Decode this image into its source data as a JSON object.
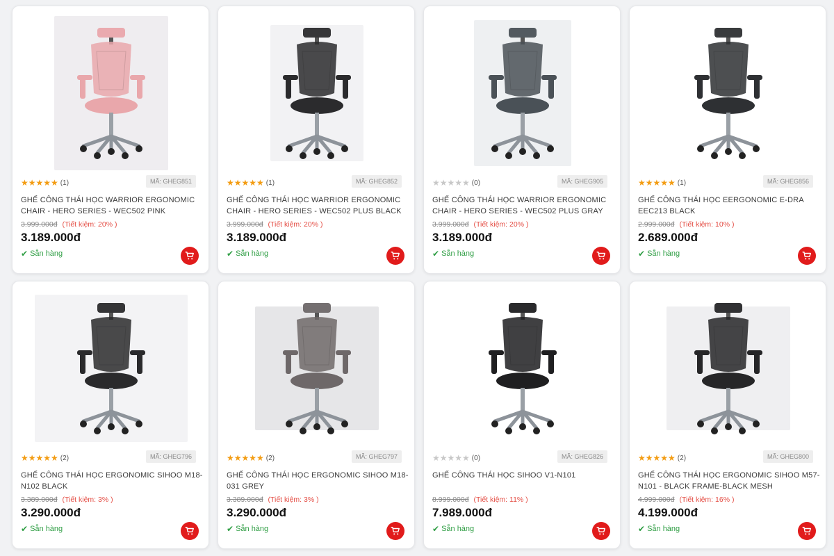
{
  "colors": {
    "accent": "#e11b1b",
    "star_filled": "#f39c12",
    "star_empty": "#c8c8c8",
    "in_stock": "#2f9e44",
    "saving": "#e44d44"
  },
  "products": [
    {
      "stars": "★★★★★",
      "rating_count": "(1)",
      "star_color": "#f39c12",
      "sku": "MÃ: GHEG851",
      "name": "GHẾ CÔNG THÁI HỌC WARRIOR ERGONOMIC CHAIR - HERO SERIES - WEC502 PINK",
      "old_price": "3.999.000đ",
      "saving": "(Tiết kiệm: 20% )",
      "price": "3.189.000đ",
      "stock": "Sẵn hàng",
      "image": "pink office chair",
      "chair_color": "#e9a7ab",
      "bg_color": "#efedf0"
    },
    {
      "stars": "★★★★★",
      "rating_count": "(1)",
      "star_color": "#f39c12",
      "sku": "MÃ: GHEG852",
      "name": "GHẾ CÔNG THÁI HỌC WARRIOR ERGONOMIC CHAIR - HERO SERIES - WEC502 PLUS BLACK",
      "old_price": "3.999.000đ",
      "saving": "(Tiết kiệm: 20% )",
      "price": "3.189.000đ",
      "stock": "Sẵn hàng",
      "image": "black office chair",
      "chair_color": "#2b2b2d",
      "bg_color": "#f2f2f4"
    },
    {
      "stars": "★★★★★",
      "rating_count": "(0)",
      "star_color": "#c8c8c8",
      "sku": "MÃ: GHEG905",
      "name": "GHẾ CÔNG THÁI HỌC WARRIOR ERGONOMIC CHAIR - HERO SERIES - WEC502 PLUS GRAY",
      "old_price": "3.999.000đ",
      "saving": "(Tiết kiệm: 20% )",
      "price": "3.189.000đ",
      "stock": "Sẵn hàng",
      "image": "gray office chair",
      "chair_color": "#4a5157",
      "bg_color": "#eef0f2"
    },
    {
      "stars": "★★★★★",
      "rating_count": "(1)",
      "star_color": "#f39c12",
      "sku": "MÃ: GHEG856",
      "name": "GHẾ CÔNG THÁI HỌC EERGONOMIC E-DRA EEC213 BLACK",
      "old_price": "2.999.000đ",
      "saving": "(Tiết kiệm: 10% )",
      "price": "2.689.000đ",
      "stock": "Sẵn hàng",
      "image": "black office chair",
      "chair_color": "#2e3033",
      "bg_color": "#ffffff"
    },
    {
      "stars": "★★★★★",
      "rating_count": "(2)",
      "star_color": "#f39c12",
      "sku": "MÃ: GHEG796",
      "name": "GHẾ CÔNG THÁI HỌC ERGONOMIC SIHOO M18-N102 BLACK",
      "old_price": "3.389.000đ",
      "saving": "(Tiết kiệm: 3% )",
      "price": "3.290.000đ",
      "stock": "Sẵn hàng",
      "image": "black office chair",
      "chair_color": "#2a2a2c",
      "bg_color": "#f3f3f5"
    },
    {
      "stars": "★★★★★",
      "rating_count": "(2)",
      "star_color": "#f39c12",
      "sku": "MÃ: GHEG797",
      "name": "GHẾ CÔNG THÁI HỌC ERGONOMIC SIHOO M18-031 GREY",
      "old_price": "3.389.000đ",
      "saving": "(Tiết kiệm: 3% )",
      "price": "3.290.000đ",
      "stock": "Sẵn hàng",
      "image": "grey office chair",
      "chair_color": "#6e6869",
      "bg_color": "#e6e6e8"
    },
    {
      "stars": "★★★★★",
      "rating_count": "(0)",
      "star_color": "#c8c8c8",
      "sku": "MÃ: GHEG826",
      "name": "GHẾ CÔNG THÁI HỌC SIHOO V1-N101",
      "old_price": "8.999.000đ",
      "saving": "(Tiết kiệm: 11% )",
      "price": "7.989.000đ",
      "stock": "Sẵn hàng",
      "image": "black office chair",
      "chair_color": "#1f1f21",
      "bg_color": "#ffffff"
    },
    {
      "stars": "★★★★★",
      "rating_count": "(2)",
      "star_color": "#f39c12",
      "sku": "MÃ: GHEG800",
      "name": "GHẾ CÔNG THÁI HỌC ERGONOMIC SIHOO M57-N101 - BLACK FRAME-BLACK MESH",
      "old_price": "4.999.000đ",
      "saving": "(Tiết kiệm: 16% )",
      "price": "4.199.000đ",
      "stock": "Sẵn hàng",
      "image": "black office chair",
      "chair_color": "#262628",
      "bg_color": "#efeff1"
    }
  ]
}
